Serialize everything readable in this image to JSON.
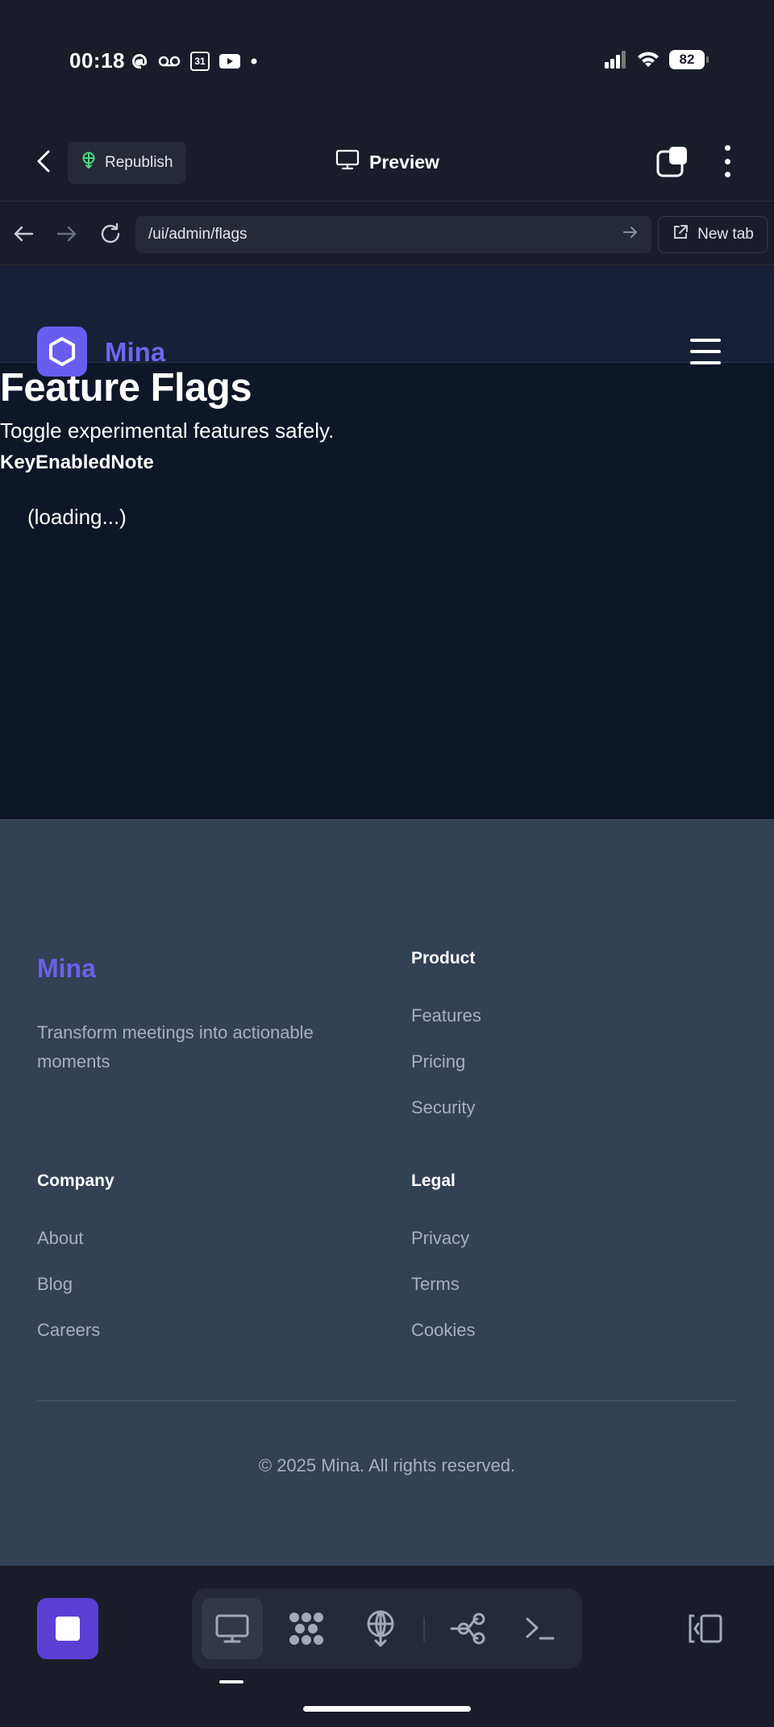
{
  "status_bar": {
    "time": "00:18",
    "calendar_day": "31",
    "battery": "82",
    "left_icons": [
      "threads-icon",
      "voicemail-icon",
      "calendar-icon",
      "youtube-icon",
      "dot-icon"
    ],
    "right_icons": [
      "signal-icon",
      "wifi-icon",
      "battery-icon"
    ]
  },
  "toolbar": {
    "republish_label": "Republish",
    "preview_label": "Preview"
  },
  "browser": {
    "url": "/ui/admin/flags",
    "new_tab_label": "New tab"
  },
  "site": {
    "brand": "Mina",
    "page_title": "Feature Flags",
    "page_subtitle": "Toggle experimental features safely.",
    "table_headers": [
      "Key",
      "Enabled",
      "Note"
    ],
    "loading_text": "(loading...)"
  },
  "footer": {
    "brand": "Mina",
    "tagline": "Transform meetings into actionable moments",
    "columns": [
      {
        "title": "Product",
        "links": [
          "Features",
          "Pricing",
          "Security"
        ]
      },
      {
        "title": "Company",
        "links": [
          "About",
          "Blog",
          "Careers"
        ]
      },
      {
        "title": "Legal",
        "links": [
          "Privacy",
          "Terms",
          "Cookies"
        ]
      }
    ],
    "copyright": "© 2025 Mina. All rights reserved."
  },
  "dock": {
    "items": [
      "desktop-icon",
      "apps-icon",
      "deploy-icon",
      "git-branch-icon",
      "terminal-icon"
    ],
    "active_item": "desktop-icon"
  },
  "colors": {
    "accent": "#6b5cf0",
    "stop_button": "#5b3fd4",
    "site_background": "#0e1628",
    "footer_background": "#334155",
    "republish_icon": "#4ade80"
  }
}
